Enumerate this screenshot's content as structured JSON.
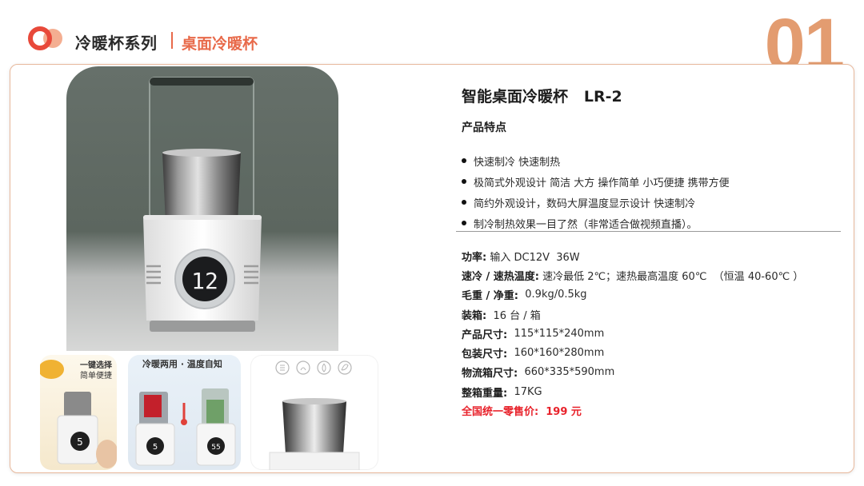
{
  "header": {
    "title": "冷暖杯系列",
    "subtitle": "桌面冷暖杯",
    "page_number": "01",
    "accent_color": "#e86a4a",
    "number_color": "#e39c70"
  },
  "product": {
    "title": "智能桌面冷暖杯   LR-2",
    "display_temperature": "12",
    "features_heading": "产品特点",
    "features": [
      "快速制冷 快速制热",
      "极简式外观设计  简洁 大方  操作简单 小巧便捷 携带方便",
      "简约外观设计，数码大屏温度显示设计 快速制冷",
      "制冷制热效果一目了然（非常适合做视频直播）。"
    ],
    "specs": [
      {
        "label": "功率:",
        "value": "输入 DC12V  36W"
      },
      {
        "label": "速冷 / 速热温度:",
        "value": "速冷最低 2℃；速热最高温度 60℃  （恒温 40-60℃ ）"
      },
      {
        "label": "毛重 / 净重:",
        "value": "0.9kg/0.5kg"
      },
      {
        "label": "装箱:",
        "value": "16 台 / 箱"
      },
      {
        "label": "产品尺寸:",
        "value": "115*115*240mm"
      },
      {
        "label": "包装尺寸:",
        "value": "160*160*280mm"
      },
      {
        "label": "物流箱尺寸:",
        "value": "660*335*590mm"
      },
      {
        "label": "整箱重量:",
        "value": "17KG"
      }
    ],
    "price": {
      "label": "全国统一零售价:",
      "value": "199 元",
      "color": "#e8212a"
    }
  },
  "thumbnails": [
    {
      "caption_line1": "一键选择",
      "caption_line2": "简单便捷",
      "display": "5"
    },
    {
      "caption": "冷暖两用 · 温度自知",
      "display_left": "5",
      "display_right": "55"
    },
    {
      "icons": [
        "snowflake-icon",
        "sun-icon",
        "drop-icon",
        "leaf-icon"
      ]
    }
  ]
}
